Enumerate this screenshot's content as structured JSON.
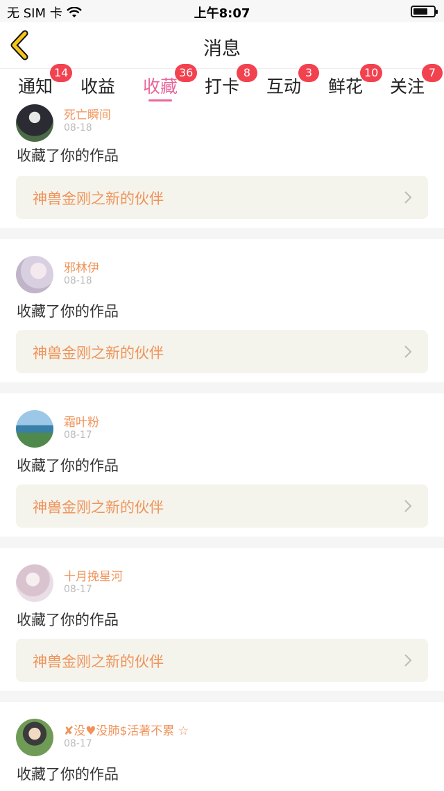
{
  "statusbar": {
    "carrier": "无 SIM 卡",
    "time": "上午8:07"
  },
  "header": {
    "title": "消息",
    "back_icon": "chevron-left-icon",
    "accent": "#f5c518"
  },
  "tabs": [
    {
      "label": "通知",
      "badge": "14",
      "active": false
    },
    {
      "label": "收益",
      "badge": "",
      "active": false
    },
    {
      "label": "收藏",
      "badge": "36",
      "active": true
    },
    {
      "label": "打卡",
      "badge": "8",
      "active": false
    },
    {
      "label": "互动",
      "badge": "3",
      "active": false
    },
    {
      "label": "鲜花",
      "badge": "10",
      "active": false
    },
    {
      "label": "关注",
      "badge": "7",
      "active": false
    }
  ],
  "colors": {
    "active_tab": "#e9679b",
    "badge": "#f2424f",
    "username": "#f0935a",
    "work_box_bg": "#f4f4ec"
  },
  "feed": [
    {
      "username": "死亡瞬间",
      "date": "08-18",
      "action": "收藏了你的作品",
      "work": "神兽金刚之新的伙伴"
    },
    {
      "username": "邪林伊",
      "date": "08-18",
      "action": "收藏了你的作品",
      "work": "神兽金刚之新的伙伴"
    },
    {
      "username": "霜叶粉",
      "date": "08-17",
      "action": "收藏了你的作品",
      "work": "神兽金刚之新的伙伴"
    },
    {
      "username": "十月挽星河",
      "date": "08-17",
      "action": "收藏了你的作品",
      "work": "神兽金刚之新的伙伴"
    },
    {
      "username": "✘没♥没肺$活著不累 ☆",
      "date": "08-17",
      "action": "收藏了你的作品",
      "work": ""
    }
  ]
}
